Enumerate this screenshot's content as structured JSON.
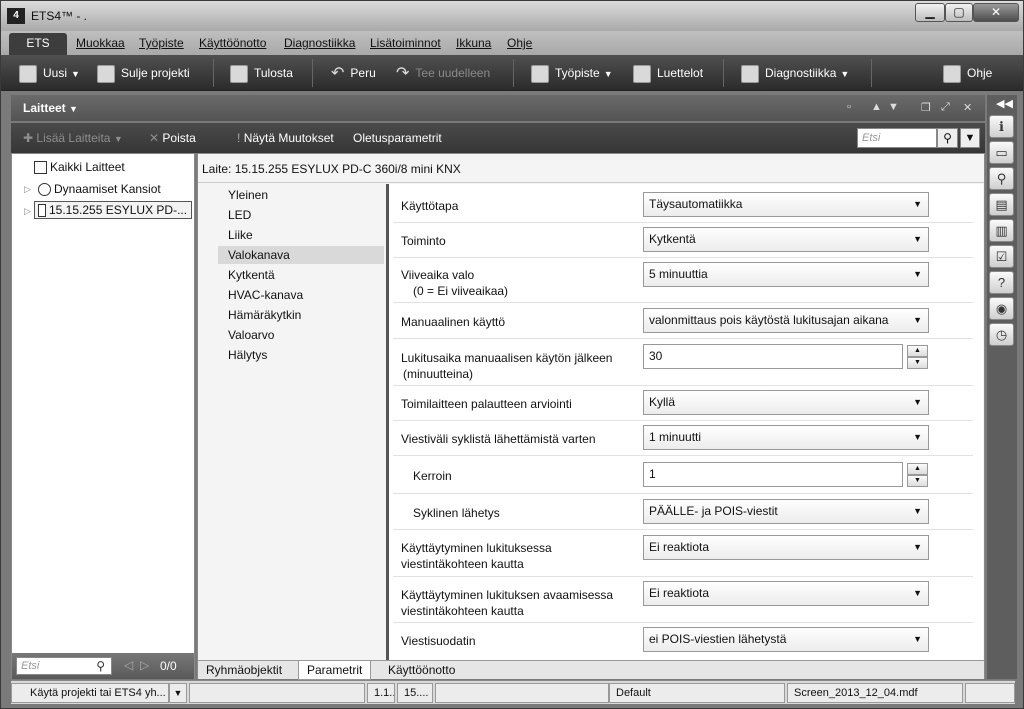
{
  "window": {
    "title": "ETS4™ - .",
    "logo": "4",
    "minimize": "▁",
    "maximize": "▢",
    "close": "✕"
  },
  "menu": {
    "ets": "ETS",
    "items": [
      "Muokkaa",
      "Työpiste",
      "Käyttöönotto",
      "Diagnostiikka",
      "Lisätoiminnot",
      "Ikkuna",
      "Ohje"
    ]
  },
  "toolbar": {
    "new": "Uusi",
    "close_project": "Sulje projekti",
    "print": "Tulosta",
    "undo": "Peru",
    "redo": "Tee uudelleen",
    "workspace": "Työpiste",
    "catalogs": "Luettelot",
    "diagnostics": "Diagnostiikka",
    "help": "Ohje"
  },
  "panel": {
    "title": "Laitteet"
  },
  "subbar": {
    "add_devices": "Lisää Laitteita",
    "delete": "Poista",
    "show_changes": "Näytä Muutokset",
    "default_params": "Oletusparametrit",
    "search_placeholder": "Etsi"
  },
  "tree": {
    "all_devices": "Kaikki Laitteet",
    "dynamic_folders": "Dynaamiset Kansiot",
    "device": "15.15.255  ESYLUX PD-...",
    "search_placeholder": "Etsi",
    "count": "0/0"
  },
  "device_title": "Laite: 15.15.255  ESYLUX PD-C 360i/8 mini KNX",
  "categories": [
    "Yleinen",
    "LED",
    "Liike",
    "Valokanava",
    "Kytkentä",
    "HVAC-kanava",
    "Hämäräkytkin",
    "Valoarvo",
    "Hälytys"
  ],
  "active_category": "Valokanava",
  "params": {
    "p1": {
      "label": "Käyttötapa",
      "value": "Täysautomatiikka"
    },
    "p2": {
      "label": "Toiminto",
      "value": "Kytkentä"
    },
    "p3": {
      "label": "Viiveaika valo",
      "sub": "(0 = Ei viiveaikaa)",
      "value": "5 minuuttia"
    },
    "p4": {
      "label": "Manuaalinen käyttö",
      "value": "valonmittaus pois käytöstä lukitusajan aikana"
    },
    "p5": {
      "label": "Lukitusaika manuaalisen käytön jälkeen",
      "sub": "(minuutteina)",
      "value": "30"
    },
    "p6": {
      "label": "Toimilaitteen palautteen arviointi",
      "value": "Kyllä"
    },
    "p7": {
      "label": "Viestiväli syklistä lähettämistä varten",
      "value": "1 minuutti"
    },
    "p8": {
      "label": "Kerroin",
      "value": "1"
    },
    "p9": {
      "label": "Syklinen lähetys",
      "value": "PÄÄLLE- ja POIS-viestit"
    },
    "p10": {
      "label": "Käyttäytyminen lukituksessa",
      "sub": "viestintäkohteen kautta",
      "value": "Ei reaktiota"
    },
    "p11": {
      "label": "Käyttäytyminen lukituksen avaamisessa",
      "sub": "viestintäkohteen kautta",
      "value": "Ei reaktiota"
    },
    "p12": {
      "label": "Viestisuodatin",
      "value": "ei POIS-viestien lähetystä"
    }
  },
  "tabs": {
    "group_objects": "Ryhmäobjektit",
    "parameters": "Parametrit",
    "commissioning": "Käyttöönotto"
  },
  "status": {
    "hint": "Käytä projekti tai ETS4 yh...",
    "s1": "1.1...",
    "s2": "15....",
    "mode": "Default",
    "file": "Screen_2013_12_04.mdf"
  }
}
